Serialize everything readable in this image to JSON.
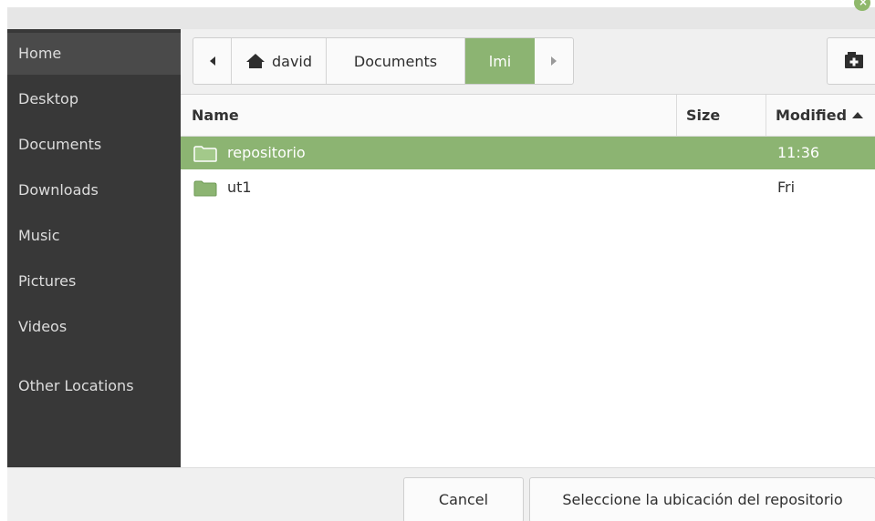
{
  "sidebar": {
    "items": [
      {
        "label": "Home"
      },
      {
        "label": "Desktop"
      },
      {
        "label": "Documents"
      },
      {
        "label": "Downloads"
      },
      {
        "label": "Music"
      },
      {
        "label": "Pictures"
      },
      {
        "label": "Videos"
      },
      {
        "label": "Other Locations"
      }
    ]
  },
  "pathbar": {
    "segments": [
      {
        "label": "david",
        "icon": "home-icon"
      },
      {
        "label": "Documents"
      },
      {
        "label": "lmi"
      }
    ]
  },
  "columns": {
    "name": "Name",
    "size": "Size",
    "modified": "Modified"
  },
  "files": [
    {
      "name": "repositorio",
      "size": "",
      "modified": "11:36",
      "type": "folder"
    },
    {
      "name": "ut1",
      "size": "",
      "modified": "Fri",
      "type": "folder"
    }
  ],
  "buttons": {
    "cancel": "Cancel",
    "select": "Seleccione la ubicación del repositorio"
  },
  "colors": {
    "accent": "#8cb472",
    "sidebar_bg": "#383838",
    "folder": "#8cb472"
  }
}
